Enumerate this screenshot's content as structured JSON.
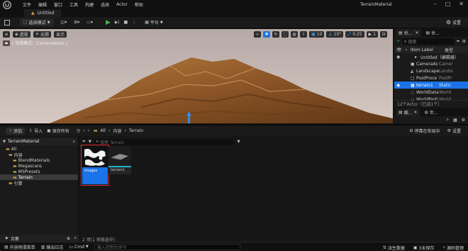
{
  "menubar": {
    "items": [
      "文件",
      "编辑",
      "窗口",
      "工具",
      "构建",
      "选择",
      "Actor",
      "帮助"
    ],
    "project_name": "TerrainMaterial"
  },
  "level_tab": {
    "label": "Untitled"
  },
  "toolbar": {
    "select_mode": "选择模式",
    "platform": "平台",
    "settings": "设置"
  },
  "viewport": {
    "view_mode": "透视",
    "lit": "光照",
    "show": "显示",
    "pilot_label": "[ 驾驶模式：CameraActor ]",
    "grid_snap": "10",
    "rotation_snap": "10°",
    "scale_snap": "0.25",
    "camera_speed": "1"
  },
  "outliner": {
    "tab_label": "世...",
    "tab2_label": "世...",
    "search_placeholder": "搜索",
    "col_label": "Item Label",
    "col_type": "类型",
    "rows": [
      {
        "label": "Untitled（编辑器）",
        "type": ""
      },
      {
        "label": "CameraAc",
        "type": "Camer"
      },
      {
        "label": "Landscape",
        "type": "Landsc"
      },
      {
        "label": "PostProce",
        "type": "PostPr"
      },
      {
        "label": "terrain1",
        "type": "Static"
      },
      {
        "label": "WorldData",
        "type": "World"
      },
      {
        "label": "WorldParti",
        "type": "World"
      }
    ],
    "status": "12个Actor（已选1个）"
  },
  "details": {
    "tab_label": "细...",
    "tab2_label": "世..."
  },
  "content_browser": {
    "add": "添加",
    "import": "导入",
    "save_all": "保存所有",
    "breadcrumb": [
      "All",
      "内容",
      "Terrain"
    ],
    "dock": "停靠在布局中",
    "settings": "设置",
    "search_placeholder": "搜索 Terrain",
    "tree_header": "TerrainMaterial",
    "tree": [
      {
        "label": "All",
        "level": 0
      },
      {
        "label": "内容",
        "level": 1
      },
      {
        "label": "BlendMaterials",
        "level": 2
      },
      {
        "label": "Megascans",
        "level": 2
      },
      {
        "label": "MSPresets",
        "level": 2
      },
      {
        "label": "Terrain",
        "level": 2
      },
      {
        "label": "引擎",
        "level": 1
      }
    ],
    "collections": "合集",
    "assets": [
      {
        "name": "images",
        "selected": true
      },
      {
        "name": "terrain1",
        "selected": false
      }
    ],
    "status": "2 项(1 项被选中)"
  },
  "statusbar": {
    "drawer": "内容侧滑菜单",
    "output_log": "输出日志",
    "cmd": "Cmd",
    "cmd_placeholder": "输入控制台命令",
    "derived_data": "派生数据",
    "unsaved": "3未保存",
    "source_control": "源码管理"
  },
  "colors": {
    "accent": "#1a73e8",
    "highlight_red": "#e0282e",
    "play_green": "#4caf50"
  }
}
